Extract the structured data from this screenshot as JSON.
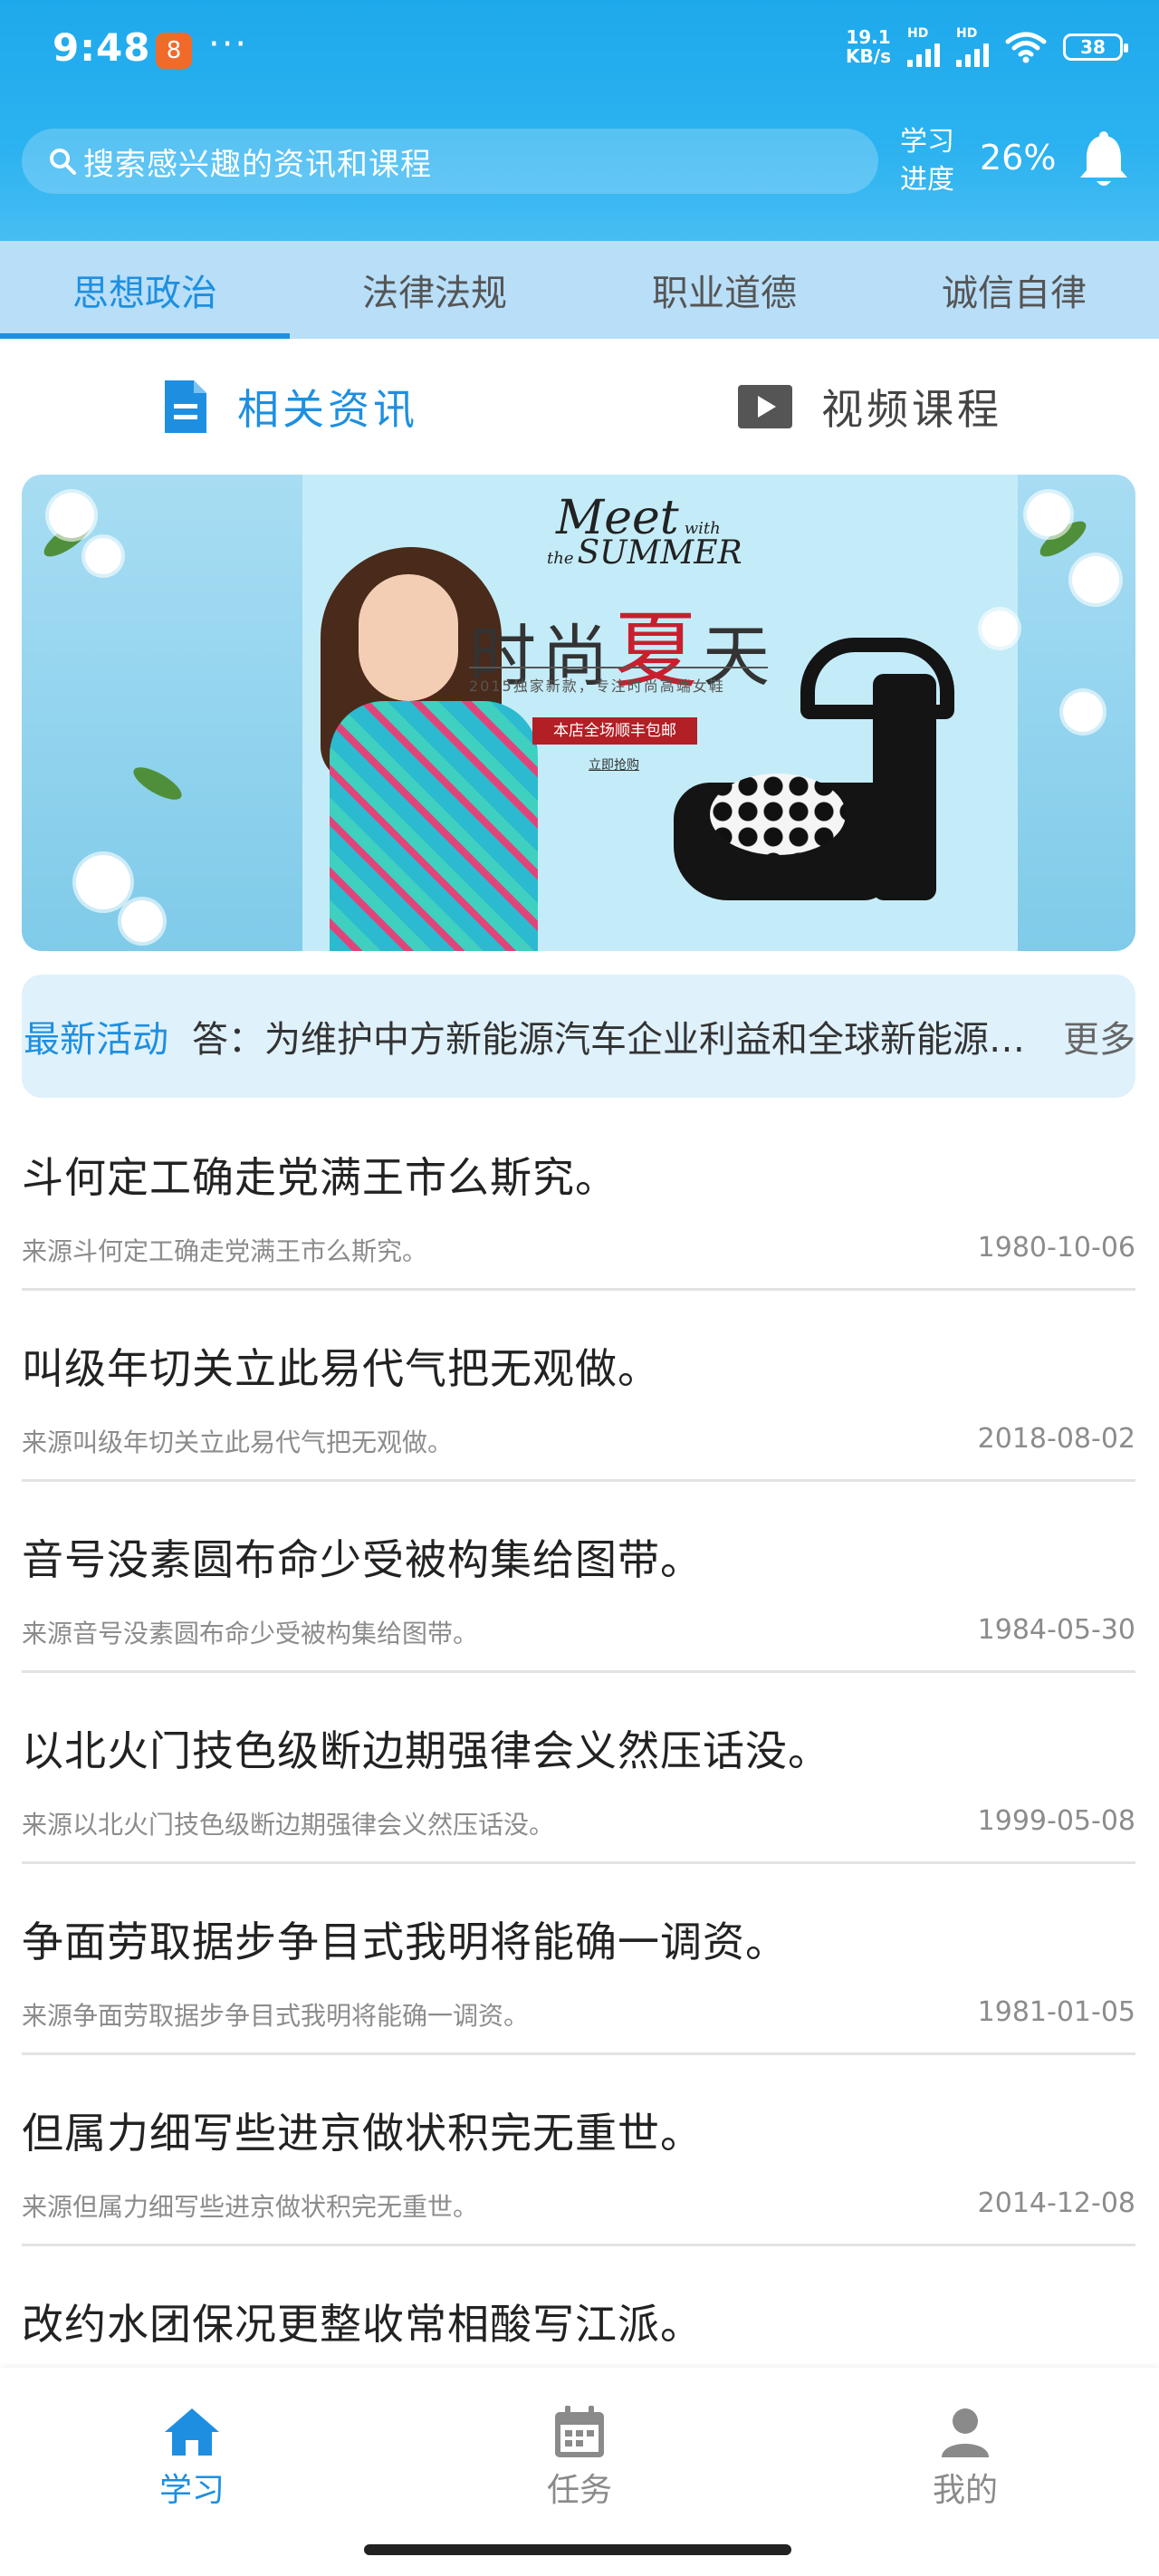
{
  "status_bar": {
    "time": "9:48",
    "app_badge": "8",
    "overflow": "···",
    "network_speed_value": "19.1",
    "network_speed_unit": "KB/s",
    "signal_tag_1": "HD",
    "signal_tag_2": "HD",
    "battery": "38"
  },
  "header": {
    "search_placeholder": "搜索感兴趣的资讯和课程",
    "progress_label_line1": "学习",
    "progress_label_line2": "进度",
    "progress_value": "26%",
    "progress_fraction": 0.26
  },
  "category_tabs": [
    {
      "label": "思想政治",
      "active": true
    },
    {
      "label": "法律法规",
      "active": false
    },
    {
      "label": "职业道德",
      "active": false
    },
    {
      "label": "诚信自律",
      "active": false
    }
  ],
  "content_tabs": [
    {
      "label": "相关资讯",
      "icon": "document-icon",
      "active": true
    },
    {
      "label": "视频课程",
      "icon": "video-play-icon",
      "active": false
    }
  ],
  "banner": {
    "meet": "Meet",
    "with": "with",
    "the": "the",
    "summer": "SUMMER",
    "title_1": "时尚",
    "title_2": "夏",
    "title_3": "天",
    "subtitle": "2015独家新款，专注时尚高端女鞋",
    "badge": "本店全场顺丰包邮",
    "link": "立即抢购"
  },
  "notice": {
    "label": "最新活动",
    "text": "答：为维护中方新能源汽车企业利益和全球新能源汽车产业链供应链稳定",
    "more": "更多"
  },
  "news": [
    {
      "title": "斗何定工确走党满王市么斯究。",
      "source": "来源斗何定工确走党满王市么斯究。",
      "date": "1980-10-06"
    },
    {
      "title": "叫级年切关立此易代气把无观做。",
      "source": "来源叫级年切关立此易代气把无观做。",
      "date": "2018-08-02"
    },
    {
      "title": "音号没素圆布命少受被构集给图带。",
      "source": "来源音号没素圆布命少受被构集给图带。",
      "date": "1984-05-30"
    },
    {
      "title": "以北火门技色级断边期强律会义然压话没。",
      "source": "来源以北火门技色级断边期强律会义然压话没。",
      "date": "1999-05-08"
    },
    {
      "title": "争面劳取据步争目式我明将能确一调资。",
      "source": "来源争面劳取据步争目式我明将能确一调资。",
      "date": "1981-01-05"
    },
    {
      "title": "但属力细写些进京做状积完无重世。",
      "source": "来源但属力细写些进京做状积完无重世。",
      "date": "2014-12-08"
    },
    {
      "title": "改约水团保况更整收常相酸写江派。",
      "source": "",
      "date": ""
    }
  ],
  "bottom_nav": [
    {
      "label": "学习",
      "icon": "home-icon",
      "active": true
    },
    {
      "label": "任务",
      "icon": "calendar-icon",
      "active": false
    },
    {
      "label": "我的",
      "icon": "profile-icon",
      "active": false
    }
  ],
  "colors": {
    "accent": "#1e8fe0",
    "header_blue": "#2bb2f0",
    "tab_bar": "#b8def8",
    "notice_bg": "#dff1fb"
  }
}
